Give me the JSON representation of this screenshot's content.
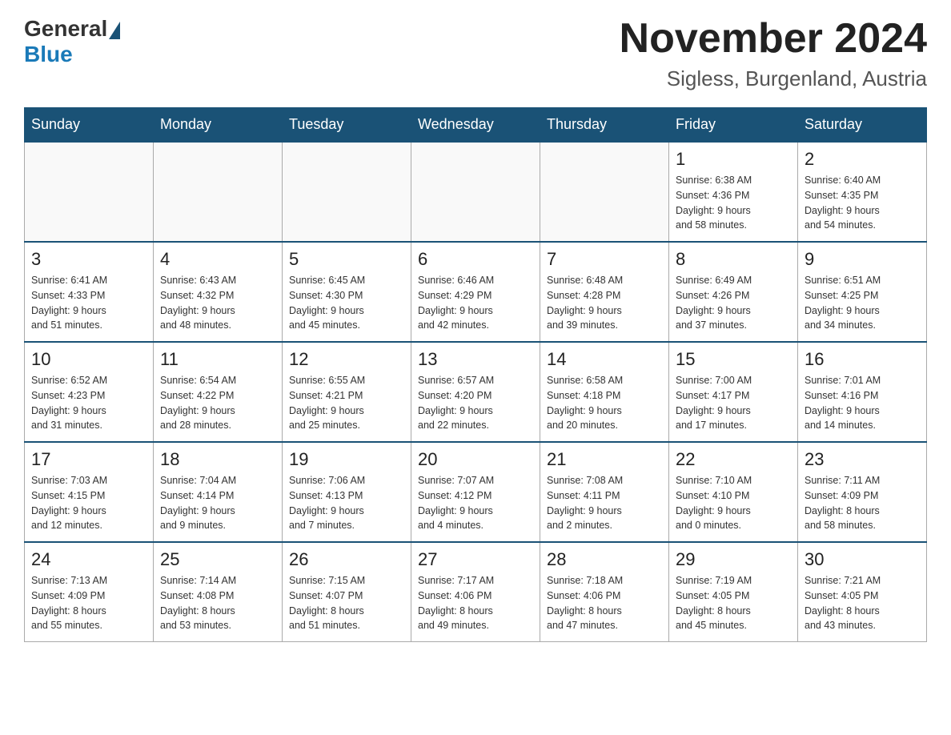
{
  "header": {
    "logo_general": "General",
    "logo_blue": "Blue",
    "month_year": "November 2024",
    "location": "Sigless, Burgenland, Austria"
  },
  "weekdays": [
    "Sunday",
    "Monday",
    "Tuesday",
    "Wednesday",
    "Thursday",
    "Friday",
    "Saturday"
  ],
  "weeks": [
    [
      {
        "day": "",
        "info": ""
      },
      {
        "day": "",
        "info": ""
      },
      {
        "day": "",
        "info": ""
      },
      {
        "day": "",
        "info": ""
      },
      {
        "day": "",
        "info": ""
      },
      {
        "day": "1",
        "info": "Sunrise: 6:38 AM\nSunset: 4:36 PM\nDaylight: 9 hours\nand 58 minutes."
      },
      {
        "day": "2",
        "info": "Sunrise: 6:40 AM\nSunset: 4:35 PM\nDaylight: 9 hours\nand 54 minutes."
      }
    ],
    [
      {
        "day": "3",
        "info": "Sunrise: 6:41 AM\nSunset: 4:33 PM\nDaylight: 9 hours\nand 51 minutes."
      },
      {
        "day": "4",
        "info": "Sunrise: 6:43 AM\nSunset: 4:32 PM\nDaylight: 9 hours\nand 48 minutes."
      },
      {
        "day": "5",
        "info": "Sunrise: 6:45 AM\nSunset: 4:30 PM\nDaylight: 9 hours\nand 45 minutes."
      },
      {
        "day": "6",
        "info": "Sunrise: 6:46 AM\nSunset: 4:29 PM\nDaylight: 9 hours\nand 42 minutes."
      },
      {
        "day": "7",
        "info": "Sunrise: 6:48 AM\nSunset: 4:28 PM\nDaylight: 9 hours\nand 39 minutes."
      },
      {
        "day": "8",
        "info": "Sunrise: 6:49 AM\nSunset: 4:26 PM\nDaylight: 9 hours\nand 37 minutes."
      },
      {
        "day": "9",
        "info": "Sunrise: 6:51 AM\nSunset: 4:25 PM\nDaylight: 9 hours\nand 34 minutes."
      }
    ],
    [
      {
        "day": "10",
        "info": "Sunrise: 6:52 AM\nSunset: 4:23 PM\nDaylight: 9 hours\nand 31 minutes."
      },
      {
        "day": "11",
        "info": "Sunrise: 6:54 AM\nSunset: 4:22 PM\nDaylight: 9 hours\nand 28 minutes."
      },
      {
        "day": "12",
        "info": "Sunrise: 6:55 AM\nSunset: 4:21 PM\nDaylight: 9 hours\nand 25 minutes."
      },
      {
        "day": "13",
        "info": "Sunrise: 6:57 AM\nSunset: 4:20 PM\nDaylight: 9 hours\nand 22 minutes."
      },
      {
        "day": "14",
        "info": "Sunrise: 6:58 AM\nSunset: 4:18 PM\nDaylight: 9 hours\nand 20 minutes."
      },
      {
        "day": "15",
        "info": "Sunrise: 7:00 AM\nSunset: 4:17 PM\nDaylight: 9 hours\nand 17 minutes."
      },
      {
        "day": "16",
        "info": "Sunrise: 7:01 AM\nSunset: 4:16 PM\nDaylight: 9 hours\nand 14 minutes."
      }
    ],
    [
      {
        "day": "17",
        "info": "Sunrise: 7:03 AM\nSunset: 4:15 PM\nDaylight: 9 hours\nand 12 minutes."
      },
      {
        "day": "18",
        "info": "Sunrise: 7:04 AM\nSunset: 4:14 PM\nDaylight: 9 hours\nand 9 minutes."
      },
      {
        "day": "19",
        "info": "Sunrise: 7:06 AM\nSunset: 4:13 PM\nDaylight: 9 hours\nand 7 minutes."
      },
      {
        "day": "20",
        "info": "Sunrise: 7:07 AM\nSunset: 4:12 PM\nDaylight: 9 hours\nand 4 minutes."
      },
      {
        "day": "21",
        "info": "Sunrise: 7:08 AM\nSunset: 4:11 PM\nDaylight: 9 hours\nand 2 minutes."
      },
      {
        "day": "22",
        "info": "Sunrise: 7:10 AM\nSunset: 4:10 PM\nDaylight: 9 hours\nand 0 minutes."
      },
      {
        "day": "23",
        "info": "Sunrise: 7:11 AM\nSunset: 4:09 PM\nDaylight: 8 hours\nand 58 minutes."
      }
    ],
    [
      {
        "day": "24",
        "info": "Sunrise: 7:13 AM\nSunset: 4:09 PM\nDaylight: 8 hours\nand 55 minutes."
      },
      {
        "day": "25",
        "info": "Sunrise: 7:14 AM\nSunset: 4:08 PM\nDaylight: 8 hours\nand 53 minutes."
      },
      {
        "day": "26",
        "info": "Sunrise: 7:15 AM\nSunset: 4:07 PM\nDaylight: 8 hours\nand 51 minutes."
      },
      {
        "day": "27",
        "info": "Sunrise: 7:17 AM\nSunset: 4:06 PM\nDaylight: 8 hours\nand 49 minutes."
      },
      {
        "day": "28",
        "info": "Sunrise: 7:18 AM\nSunset: 4:06 PM\nDaylight: 8 hours\nand 47 minutes."
      },
      {
        "day": "29",
        "info": "Sunrise: 7:19 AM\nSunset: 4:05 PM\nDaylight: 8 hours\nand 45 minutes."
      },
      {
        "day": "30",
        "info": "Sunrise: 7:21 AM\nSunset: 4:05 PM\nDaylight: 8 hours\nand 43 minutes."
      }
    ]
  ]
}
